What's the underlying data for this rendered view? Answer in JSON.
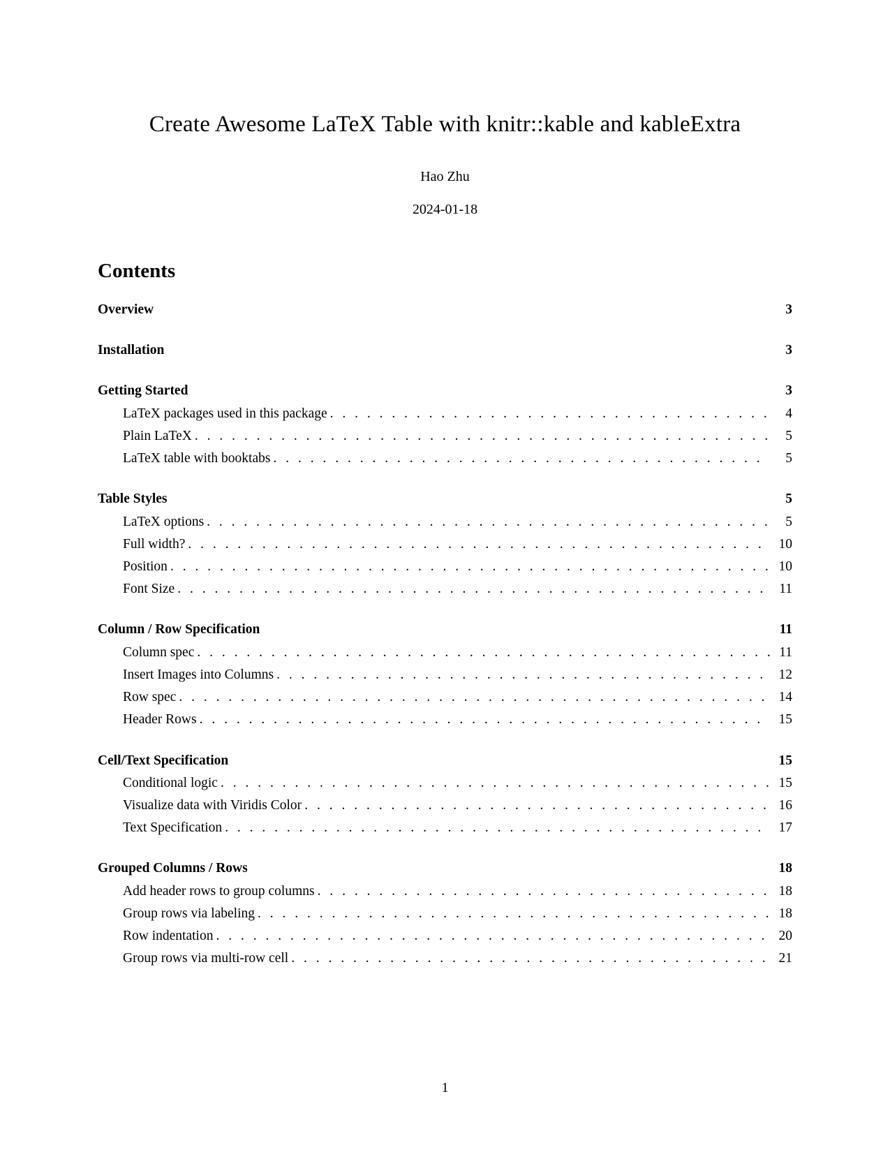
{
  "title": "Create Awesome LaTeX Table with knitr::kable and kableExtra",
  "author": "Hao Zhu",
  "date": "2024-01-18",
  "contents_heading": "Contents",
  "page_number": "1",
  "toc": [
    {
      "heading": {
        "title": "Overview",
        "page": "3"
      },
      "items": []
    },
    {
      "heading": {
        "title": "Installation",
        "page": "3"
      },
      "items": []
    },
    {
      "heading": {
        "title": "Getting Started",
        "page": "3"
      },
      "items": [
        {
          "title": "LaTeX packages used in this package",
          "page": "4"
        },
        {
          "title": "Plain LaTeX",
          "page": "5"
        },
        {
          "title": "LaTeX table with booktabs",
          "page": "5"
        }
      ]
    },
    {
      "heading": {
        "title": "Table Styles",
        "page": "5"
      },
      "items": [
        {
          "title": "LaTeX options",
          "page": "5"
        },
        {
          "title": "Full width?",
          "page": "10"
        },
        {
          "title": "Position",
          "page": "10"
        },
        {
          "title": "Font Size",
          "page": "11"
        }
      ]
    },
    {
      "heading": {
        "title": "Column / Row Specification",
        "page": "11"
      },
      "items": [
        {
          "title": "Column spec",
          "page": "11"
        },
        {
          "title": "Insert Images into Columns",
          "page": "12"
        },
        {
          "title": "Row spec",
          "page": "14"
        },
        {
          "title": "Header Rows",
          "page": "15"
        }
      ]
    },
    {
      "heading": {
        "title": "Cell/Text Specification",
        "page": "15"
      },
      "items": [
        {
          "title": "Conditional logic",
          "page": "15"
        },
        {
          "title": "Visualize data with Viridis Color",
          "page": "16"
        },
        {
          "title": "Text Specification",
          "page": "17"
        }
      ]
    },
    {
      "heading": {
        "title": "Grouped Columns / Rows",
        "page": "18"
      },
      "items": [
        {
          "title": "Add header rows to group columns",
          "page": "18"
        },
        {
          "title": "Group rows via labeling",
          "page": "18"
        },
        {
          "title": "Row indentation",
          "page": "20"
        },
        {
          "title": "Group rows via multi-row cell",
          "page": "21"
        }
      ]
    }
  ]
}
